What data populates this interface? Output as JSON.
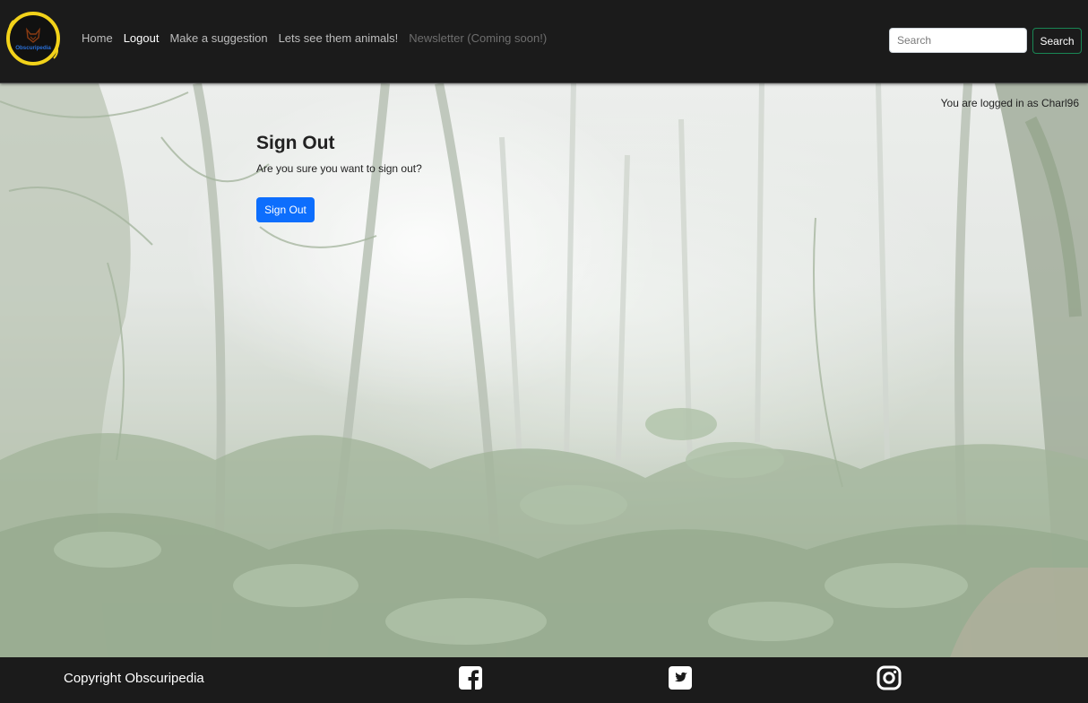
{
  "brand": {
    "logo_text": "Obscuripedia",
    "colors": {
      "ring": "#f2d21a",
      "text": "#2a6fd6",
      "fox": "#8a3b12"
    }
  },
  "nav": {
    "links": [
      {
        "label": "Home",
        "state": "normal"
      },
      {
        "label": "Logout",
        "state": "active"
      },
      {
        "label": "Make a suggestion",
        "state": "normal"
      },
      {
        "label": "Lets see them animals!",
        "state": "normal"
      },
      {
        "label": "Newsletter (Coming soon!)",
        "state": "disabled"
      }
    ]
  },
  "search": {
    "placeholder": "Search",
    "value": "",
    "button_label": "Search",
    "button_color": "#198754"
  },
  "user": {
    "logged_in_text": "You are logged in as Charl96"
  },
  "signout": {
    "title": "Sign Out",
    "message": "Are you sure you want to sign out?",
    "button_label": "Sign Out",
    "button_color": "#0d6efd"
  },
  "footer": {
    "copyright": "Copyright Obscuripedia",
    "social_icons": [
      "facebook-icon",
      "twitter-icon",
      "instagram-icon"
    ]
  },
  "colors": {
    "navbar_bg": "#1b1b1b",
    "footer_bg": "#1b1b1b"
  }
}
